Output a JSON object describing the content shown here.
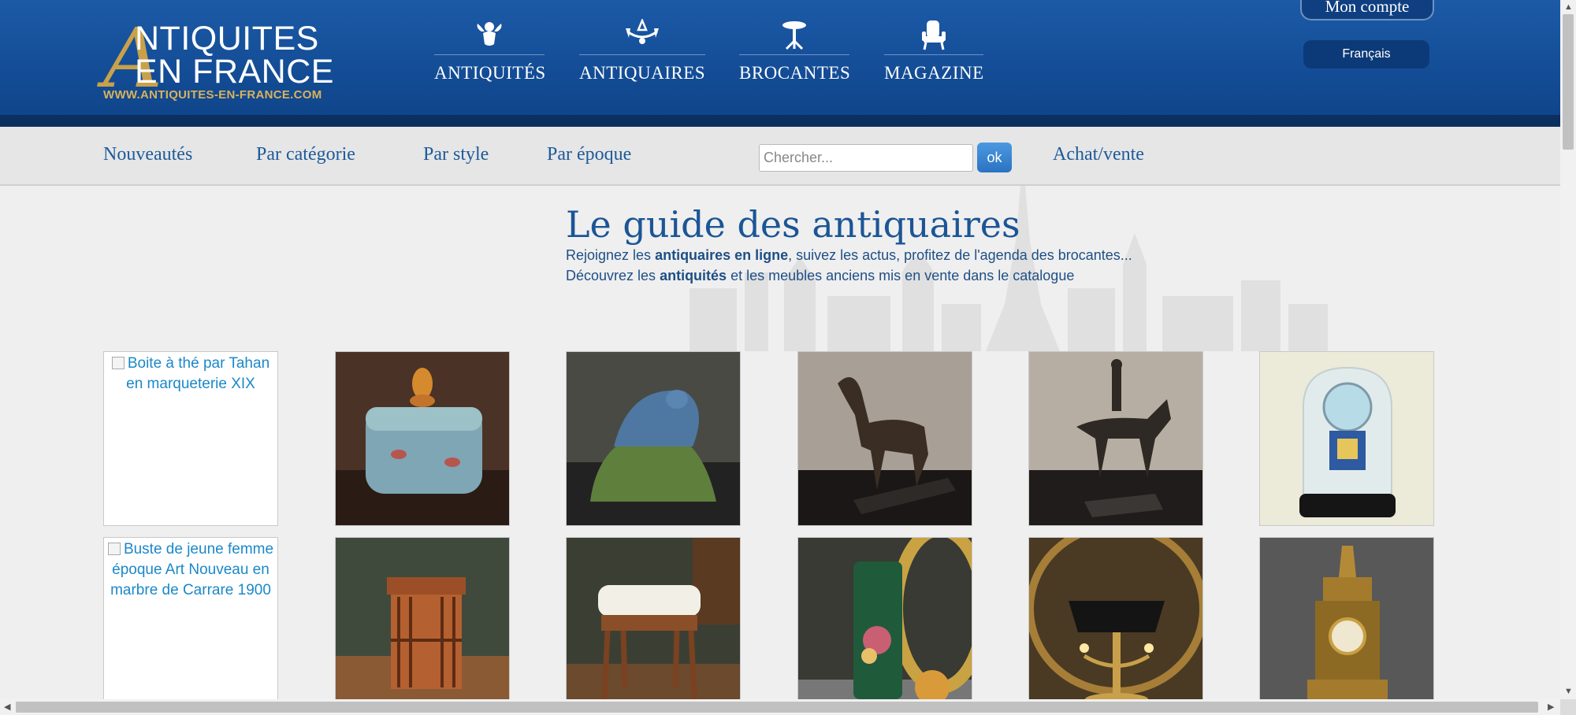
{
  "header": {
    "logo": {
      "line1": "NTIQUITES",
      "line2": "EN FRANCE",
      "big_letter": "A",
      "url": "WWW.ANTIQUITES-EN-FRANCE.COM"
    },
    "top_nav": [
      {
        "label": "ANTIQUITÉS",
        "icon": "cherub-icon"
      },
      {
        "label": "ANTIQUAIRES",
        "icon": "chandelier-icon"
      },
      {
        "label": "BROCANTES",
        "icon": "pedestal-table-icon"
      },
      {
        "label": "MAGAZINE",
        "icon": "armchair-icon"
      }
    ],
    "account_label": "Mon compte",
    "language_label": "Français"
  },
  "subnav": {
    "links": [
      "Nouveautés",
      "Par catégorie",
      "Par style",
      "Par époque"
    ],
    "search_placeholder": "Chercher...",
    "search_button": "ok",
    "buy_sell": "Achat/vente"
  },
  "intro": {
    "title": "Le guide des antiquaires",
    "line1_a": "Rejoignez les ",
    "line1_b": "antiquaires en ligne",
    "line1_c": ", suivez les actus, profitez de l'agenda des brocantes...",
    "line2_a": "Découvrez les ",
    "line2_b": "antiquités",
    "line2_c": " et les meubles anciens mis en vente dans le catalogue"
  },
  "gallery": {
    "row1_broken_alt": "Boite à thé par Tahan en marqueterie XIX",
    "row2_broken_alt": "Buste de jeune femme époque Art Nouveau en marbre de Carrare 1900",
    "row1_items": [
      "enamel-box",
      "ceramic-mouse",
      "bronze-horse",
      "bronze-rider",
      "glass-dome-clock"
    ],
    "row2_items": [
      "revolving-bookcase",
      "upholstered-stool",
      "painted-vase",
      "bouillotte-lamp",
      "gilt-bronze-clock"
    ]
  },
  "colors": {
    "header_blue": "#134c95",
    "header_dark": "#0b2f5f",
    "logo_gold": "#c9a14a",
    "link_blue": "#1d5a9a",
    "title_blue": "#1b5596"
  }
}
